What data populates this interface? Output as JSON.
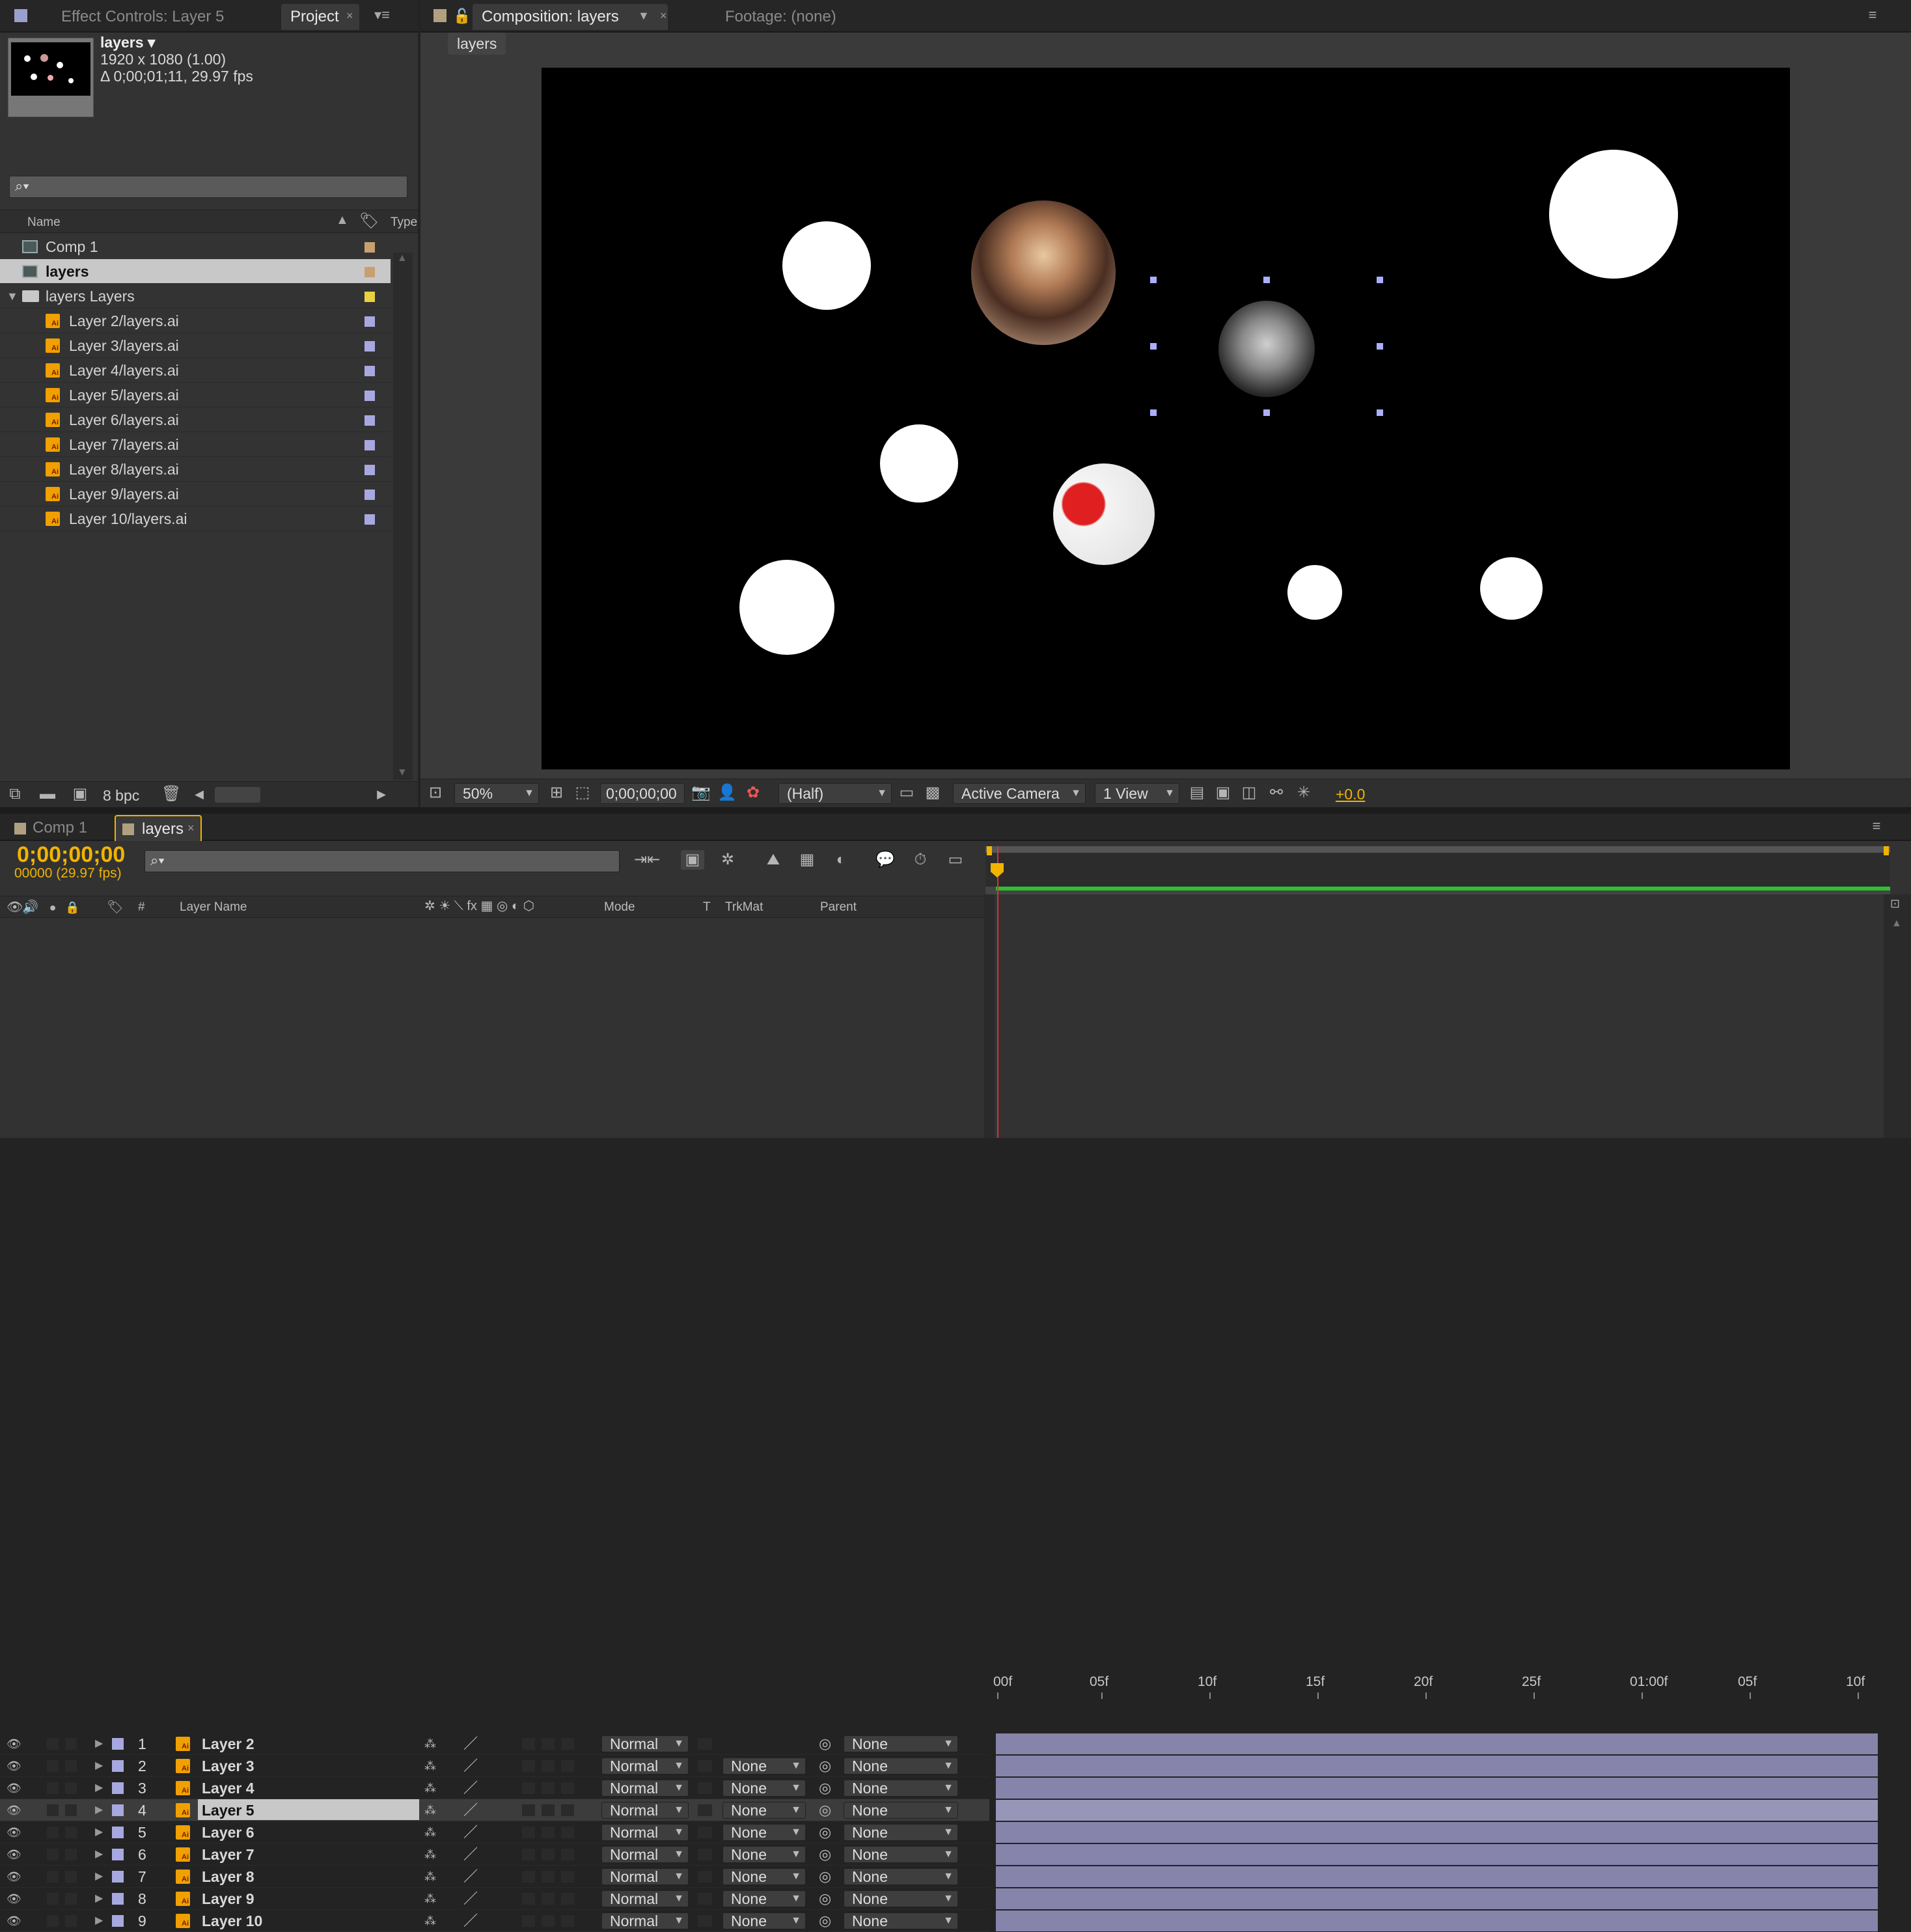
{
  "left_panel": {
    "tabs": [
      {
        "label": "Effect Controls: Layer 5"
      },
      {
        "label": "Project"
      }
    ],
    "preview": {
      "name": "layers ▾",
      "resolution": "1920 x 1080 (1.00)",
      "duration": "Δ 0;00;01;11, 29.97 fps"
    },
    "columns": {
      "name": "Name",
      "type": "Type"
    },
    "items": [
      {
        "label": "Comp 1",
        "kind": "comp",
        "color": "#c8a070"
      },
      {
        "label": "layers",
        "kind": "comp",
        "color": "#c8a070",
        "selected": true
      },
      {
        "label": "layers Layers",
        "kind": "folder",
        "color": "#e8d040"
      },
      {
        "label": "Layer 2/layers.ai",
        "kind": "ai",
        "color": "#a8a8e0"
      },
      {
        "label": "Layer 3/layers.ai",
        "kind": "ai",
        "color": "#a8a8e0"
      },
      {
        "label": "Layer 4/layers.ai",
        "kind": "ai",
        "color": "#a8a8e0"
      },
      {
        "label": "Layer 5/layers.ai",
        "kind": "ai",
        "color": "#a8a8e0"
      },
      {
        "label": "Layer 6/layers.ai",
        "kind": "ai",
        "color": "#a8a8e0"
      },
      {
        "label": "Layer 7/layers.ai",
        "kind": "ai",
        "color": "#a8a8e0"
      },
      {
        "label": "Layer 8/layers.ai",
        "kind": "ai",
        "color": "#a8a8e0"
      },
      {
        "label": "Layer 9/layers.ai",
        "kind": "ai",
        "color": "#a8a8e0"
      },
      {
        "label": "Layer 10/layers.ai",
        "kind": "ai",
        "color": "#a8a8e0"
      }
    ],
    "bpc": "8 bpc"
  },
  "comp_panel": {
    "tabs": [
      {
        "label": "Composition: layers"
      },
      {
        "label": "Footage: (none)"
      }
    ],
    "breadcrumb": "layers",
    "zoom": "50%",
    "timecode": "0;00;00;00",
    "resolution": "(Half)",
    "camera": "Active Camera",
    "views": "1 View",
    "exposure": "+0.0"
  },
  "timeline": {
    "tabs": [
      {
        "label": "Comp 1"
      },
      {
        "label": "layers"
      }
    ],
    "timecode": "0;00;00;00",
    "frame_info": "00000 (29.97 fps)",
    "columns": {
      "num": "#",
      "layer_name": "Layer Name",
      "mode": "Mode",
      "t": "T",
      "trkmat": "TrkMat",
      "parent": "Parent"
    },
    "ruler": [
      "00f",
      "05f",
      "10f",
      "15f",
      "20f",
      "25f",
      "01:00f",
      "05f",
      "10f"
    ],
    "layers": [
      {
        "num": "1",
        "name": "Layer 2",
        "mode": "Normal",
        "trkmat": "",
        "parent": "None"
      },
      {
        "num": "2",
        "name": "Layer 3",
        "mode": "Normal",
        "trkmat": "None",
        "parent": "None"
      },
      {
        "num": "3",
        "name": "Layer 4",
        "mode": "Normal",
        "trkmat": "None",
        "parent": "None"
      },
      {
        "num": "4",
        "name": "Layer 5",
        "mode": "Normal",
        "trkmat": "None",
        "parent": "None",
        "selected": true
      },
      {
        "num": "5",
        "name": "Layer 6",
        "mode": "Normal",
        "trkmat": "None",
        "parent": "None"
      },
      {
        "num": "6",
        "name": "Layer 7",
        "mode": "Normal",
        "trkmat": "None",
        "parent": "None"
      },
      {
        "num": "7",
        "name": "Layer 8",
        "mode": "Normal",
        "trkmat": "None",
        "parent": "None"
      },
      {
        "num": "8",
        "name": "Layer 9",
        "mode": "Normal",
        "trkmat": "None",
        "parent": "None"
      },
      {
        "num": "9",
        "name": "Layer 10",
        "mode": "Normal",
        "trkmat": "None",
        "parent": "None"
      }
    ]
  },
  "colors": {
    "accent": "#f0b400",
    "track": "#8784ab",
    "work_area": "#2ec02e",
    "playhead": "#e03030"
  }
}
